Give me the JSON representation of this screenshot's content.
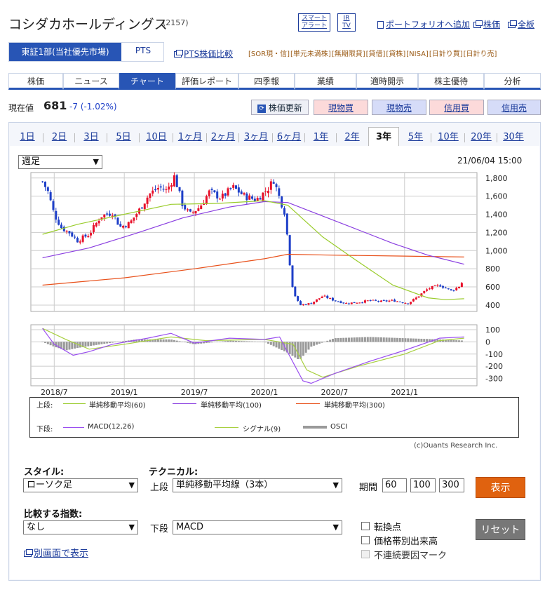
{
  "header": {
    "company": "コシダカホールディングス",
    "code": "(2157)",
    "btn_alert": "スマート\nアラート",
    "btn_irtv": "IR\nTV",
    "link_portfolio": "ポートフォリオへ追加",
    "link_price": "株価",
    "link_full": "全板"
  },
  "market": {
    "tab_tse": "東証1部(当社優先市場)",
    "tab_pts": "PTS",
    "link_pts": "PTS株価比較",
    "tags": [
      "[SOR現・信]",
      "[単元未満株]",
      "[無期限貸]",
      "[貸借]",
      "[貸株]",
      "[NISA]",
      "[日計り買]",
      "[日計り売]"
    ]
  },
  "nav": [
    "株価",
    "ニュース",
    "チャート",
    "評価レポート",
    "四季報",
    "業績",
    "適時開示",
    "株主優待",
    "分析"
  ],
  "price": {
    "label": "現在値",
    "value": "681",
    "change": "-7 (-1.02%)",
    "refresh": "株価更新",
    "buy_cash": "現物買",
    "sell_cash": "現物売",
    "buy_margin": "信用買",
    "sell_margin": "信用売"
  },
  "periods": [
    "1日",
    "2日",
    "3日",
    "5日",
    "10日",
    "1ヶ月",
    "2ヶ月",
    "3ヶ月",
    "6ヶ月",
    "1年",
    "2年",
    "3年",
    "5年",
    "10年",
    "20年",
    "30年"
  ],
  "chart": {
    "interval": "週足",
    "timestamp": "21/06/04 15:00",
    "copyright": "(c)Ouants Research Inc."
  },
  "colors": {
    "up": "#e8102a",
    "down": "#1e3fc8",
    "ma60": "#9acc2c",
    "ma100": "#8a3ee0",
    "ma300": "#e8501a",
    "macd": "#9a4ef0",
    "signal": "#a8d040",
    "osci": "#9a9a9a"
  },
  "chart_data": {
    "type": "candlestick",
    "price_axis": {
      "ticks": [
        1800,
        1600,
        1400,
        1200,
        1000,
        800,
        600,
        400
      ],
      "ylim": [
        330,
        1860
      ]
    },
    "macd_axis": {
      "ticks": [
        100,
        0,
        -100,
        -200,
        -300
      ],
      "ylim": [
        -360,
        140
      ]
    },
    "x_ticks": [
      "2018/7",
      "2019/1",
      "2019/7",
      "2020/1",
      "2020/7",
      "2021/1"
    ],
    "x_range": [
      "2018-05",
      "2021-06"
    ],
    "close_points": [
      [
        "2018-06-01",
        1760
      ],
      [
        "2018-06-15",
        1650
      ],
      [
        "2018-07-01",
        1400
      ],
      [
        "2018-07-20",
        1250
      ],
      [
        "2018-08-10",
        1200
      ],
      [
        "2018-09-01",
        1110
      ],
      [
        "2018-10-01",
        1180
      ],
      [
        "2018-11-01",
        1380
      ],
      [
        "2018-12-01",
        1420
      ],
      [
        "2018-12-20",
        1260
      ],
      [
        "2019-01-15",
        1300
      ],
      [
        "2019-02-10",
        1450
      ],
      [
        "2019-03-05",
        1620
      ],
      [
        "2019-04-01",
        1700
      ],
      [
        "2019-04-20",
        1660
      ],
      [
        "2019-05-10",
        1820
      ],
      [
        "2019-06-01",
        1500
      ],
      [
        "2019-06-20",
        1400
      ],
      [
        "2019-07-15",
        1480
      ],
      [
        "2019-08-10",
        1650
      ],
      [
        "2019-09-10",
        1580
      ],
      [
        "2019-10-10",
        1700
      ],
      [
        "2019-11-10",
        1600
      ],
      [
        "2019-12-10",
        1560
      ],
      [
        "2020-01-10",
        1680
      ],
      [
        "2020-01-25",
        1780
      ],
      [
        "2020-02-10",
        1580
      ],
      [
        "2020-02-25",
        1400
      ],
      [
        "2020-03-05",
        900
      ],
      [
        "2020-03-15",
        550
      ],
      [
        "2020-04-01",
        400
      ],
      [
        "2020-05-01",
        420
      ],
      [
        "2020-06-01",
        500
      ],
      [
        "2020-07-01",
        450
      ],
      [
        "2020-08-01",
        420
      ],
      [
        "2020-09-01",
        430
      ],
      [
        "2020-10-01",
        450
      ],
      [
        "2020-11-01",
        440
      ],
      [
        "2020-12-01",
        450
      ],
      [
        "2021-01-10",
        420
      ],
      [
        "2021-02-01",
        480
      ],
      [
        "2021-03-01",
        580
      ],
      [
        "2021-04-01",
        620
      ],
      [
        "2021-05-01",
        560
      ],
      [
        "2021-05-20",
        600
      ],
      [
        "2021-06-04",
        681
      ]
    ],
    "series": [
      {
        "name": "単純移動平均(60)",
        "points": [
          [
            "2018-06-01",
            1180
          ],
          [
            "2018-09-01",
            1290
          ],
          [
            "2019-01-01",
            1400
          ],
          [
            "2019-05-01",
            1510
          ],
          [
            "2019-09-01",
            1520
          ],
          [
            "2020-01-01",
            1550
          ],
          [
            "2020-03-01",
            1500
          ],
          [
            "2020-06-01",
            1150
          ],
          [
            "2020-09-01",
            880
          ],
          [
            "2020-12-01",
            620
          ],
          [
            "2021-03-01",
            480
          ],
          [
            "2021-04-15",
            460
          ],
          [
            "2021-06-04",
            470
          ]
        ]
      },
      {
        "name": "単純移動平均(100)",
        "points": [
          [
            "2018-06-01",
            920
          ],
          [
            "2018-10-01",
            1030
          ],
          [
            "2019-02-01",
            1190
          ],
          [
            "2019-06-01",
            1360
          ],
          [
            "2019-10-01",
            1480
          ],
          [
            "2020-01-01",
            1540
          ],
          [
            "2020-03-01",
            1530
          ],
          [
            "2020-06-01",
            1380
          ],
          [
            "2020-09-01",
            1230
          ],
          [
            "2020-12-01",
            1080
          ],
          [
            "2021-03-01",
            950
          ],
          [
            "2021-06-04",
            850
          ]
        ]
      },
      {
        "name": "単純移動平均(300)",
        "points": [
          [
            "2018-06-01",
            620
          ],
          [
            "2019-01-01",
            700
          ],
          [
            "2019-07-01",
            800
          ],
          [
            "2020-01-01",
            910
          ],
          [
            "2020-03-01",
            960
          ],
          [
            "2020-07-01",
            950
          ],
          [
            "2021-01-01",
            940
          ],
          [
            "2021-06-04",
            930
          ]
        ]
      },
      {
        "name": "MACD(12,26)",
        "points": [
          [
            "2018-06-01",
            110
          ],
          [
            "2018-07-01",
            -20
          ],
          [
            "2018-08-20",
            -110
          ],
          [
            "2018-10-01",
            -80
          ],
          [
            "2018-12-01",
            -20
          ],
          [
            "2019-03-01",
            30
          ],
          [
            "2019-05-01",
            70
          ],
          [
            "2019-07-01",
            -10
          ],
          [
            "2019-10-01",
            30
          ],
          [
            "2020-01-01",
            20
          ],
          [
            "2020-02-10",
            40
          ],
          [
            "2020-03-10",
            -140
          ],
          [
            "2020-04-10",
            -320
          ],
          [
            "2020-05-01",
            -340
          ],
          [
            "2020-07-01",
            -260
          ],
          [
            "2020-10-01",
            -160
          ],
          [
            "2021-01-01",
            -70
          ],
          [
            "2021-04-01",
            30
          ],
          [
            "2021-06-04",
            40
          ]
        ]
      },
      {
        "name": "シグナル(9)",
        "points": [
          [
            "2018-06-01",
            110
          ],
          [
            "2018-08-01",
            20
          ],
          [
            "2018-10-01",
            -60
          ],
          [
            "2019-01-01",
            -20
          ],
          [
            "2019-05-01",
            40
          ],
          [
            "2019-08-01",
            10
          ],
          [
            "2020-01-01",
            20
          ],
          [
            "2020-03-15",
            -20
          ],
          [
            "2020-04-20",
            -230
          ],
          [
            "2020-06-01",
            -290
          ],
          [
            "2020-09-01",
            -200
          ],
          [
            "2021-01-01",
            -100
          ],
          [
            "2021-04-01",
            10
          ],
          [
            "2021-06-04",
            30
          ]
        ]
      },
      {
        "name": "OSCI",
        "bars": [
          [
            "2018-06-01",
            0
          ],
          [
            "2018-07-01",
            -40
          ],
          [
            "2018-08-01",
            -70
          ],
          [
            "2018-09-01",
            -50
          ],
          [
            "2018-11-01",
            -20
          ],
          [
            "2019-02-01",
            20
          ],
          [
            "2019-05-01",
            20
          ],
          [
            "2019-07-01",
            -20
          ],
          [
            "2019-10-01",
            10
          ],
          [
            "2020-01-01",
            0
          ],
          [
            "2020-03-01",
            -90
          ],
          [
            "2020-04-01",
            -150
          ],
          [
            "2020-05-01",
            -40
          ],
          [
            "2020-07-01",
            30
          ],
          [
            "2020-10-01",
            40
          ],
          [
            "2021-01-01",
            30
          ],
          [
            "2021-04-01",
            20
          ],
          [
            "2021-06-04",
            10
          ]
        ]
      }
    ]
  },
  "legend": {
    "upper": "上段:",
    "lower": "下段:",
    "ma60": "単純移動平均(60)",
    "ma100": "単純移動平均(100)",
    "ma300": "単純移動平均(300)",
    "macd": "MACD(12,26)",
    "signal": "シグナル(9)",
    "osci": "OSCI"
  },
  "controls": {
    "style_label": "スタイル:",
    "style_value": "ローソク足",
    "tech_label": "テクニカル:",
    "upper_label": "上段",
    "upper_value": "単純移動平均線（3本）",
    "period_label": "期間",
    "p1": "60",
    "p2": "100",
    "p3": "300",
    "show": "表示",
    "compare_label": "比較する指数:",
    "compare_value": "なし",
    "lower_label": "下段",
    "lower_value": "MACD",
    "reset": "リセット",
    "cb1": "転換点",
    "cb2": "価格帯別出来高",
    "cb3": "不連続要因マーク",
    "open_new": "別画面で表示"
  }
}
